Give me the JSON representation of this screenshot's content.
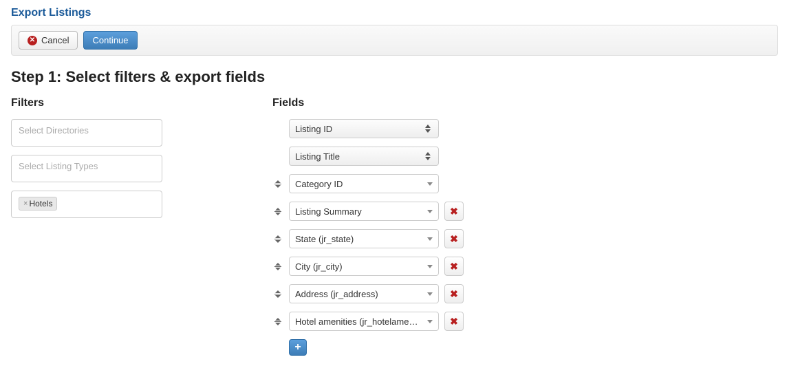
{
  "page": {
    "title": "Export Listings",
    "step_title": "Step 1: Select filters & export fields"
  },
  "toolbar": {
    "cancel_label": "Cancel",
    "continue_label": "Continue"
  },
  "filters": {
    "heading": "Filters",
    "directories_placeholder": "Select Directories",
    "listing_types_placeholder": "Select Listing Types",
    "categories_tags": [
      {
        "label": "Hotels"
      }
    ]
  },
  "fields": {
    "heading": "Fields",
    "locked": [
      {
        "label": "Listing ID"
      },
      {
        "label": "Listing Title"
      }
    ],
    "rows": [
      {
        "label": "Category ID",
        "removable": false
      },
      {
        "label": "Listing Summary",
        "removable": true
      },
      {
        "label": "State (jr_state)",
        "removable": true
      },
      {
        "label": "City (jr_city)",
        "removable": true
      },
      {
        "label": "Address (jr_address)",
        "removable": true
      },
      {
        "label": "Hotel amenities (jr_hotelameni…",
        "removable": true
      }
    ],
    "add_label": "+"
  }
}
